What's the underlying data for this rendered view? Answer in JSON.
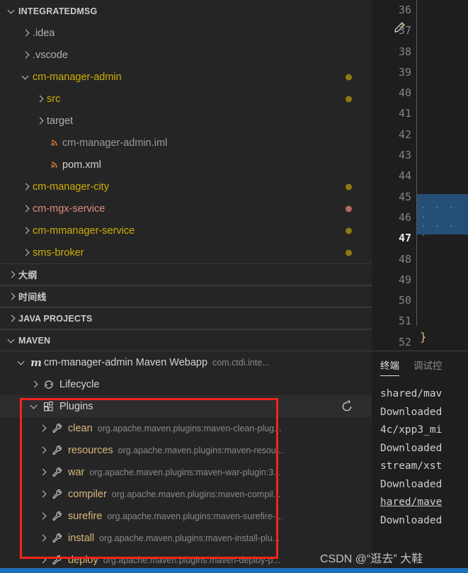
{
  "theme": {
    "sidebar_bg": "#252526",
    "editor_bg": "#1e1e1e",
    "accent_red": "#f5231b",
    "status_blue": "#1d6fb8",
    "folder_yellow": "#dcb67a",
    "modified_dot": "#8c7a11",
    "error_dot": "#b5695f",
    "selection_blue": "#264f78"
  },
  "explorer": {
    "root": {
      "label": "INTEGRATEDMSG",
      "expanded": true
    },
    "items": [
      {
        "label": ".idea",
        "kind": "folder",
        "indent": 1,
        "expanded": false,
        "color": "#b0b0b0",
        "dot": null
      },
      {
        "label": ".vscode",
        "kind": "folder",
        "indent": 1,
        "expanded": false,
        "color": "#b0b0b0",
        "dot": null
      },
      {
        "label": "cm-manager-admin",
        "kind": "folder",
        "indent": 1,
        "expanded": true,
        "color": "#cfae00",
        "dot": "#8c7a11"
      },
      {
        "label": "src",
        "kind": "folder",
        "indent": 2,
        "expanded": false,
        "color": "#cfae00",
        "dot": "#8c7a11"
      },
      {
        "label": "target",
        "kind": "folder",
        "indent": 2,
        "expanded": false,
        "color": "#b0b0b0",
        "dot": null
      },
      {
        "label": "cm-manager-admin.iml",
        "kind": "xml",
        "indent": 2,
        "expanded": null,
        "color": "#9b9b9b",
        "dot": null
      },
      {
        "label": "pom.xml",
        "kind": "xml",
        "indent": 2,
        "expanded": null,
        "color": "#d4d4d4",
        "dot": null
      },
      {
        "label": "cm-manager-city",
        "kind": "folder",
        "indent": 1,
        "expanded": false,
        "color": "#cfae00",
        "dot": "#8c7a11"
      },
      {
        "label": "cm-mgx-service",
        "kind": "folder",
        "indent": 1,
        "expanded": false,
        "color": "#e08b7c",
        "dot": "#b5695f"
      },
      {
        "label": "cm-mmanager-service",
        "kind": "folder",
        "indent": 1,
        "expanded": false,
        "color": "#cfae00",
        "dot": "#8c7a11"
      },
      {
        "label": "sms-broker",
        "kind": "folder",
        "indent": 1,
        "expanded": false,
        "color": "#cfae00",
        "dot": "#8c7a11"
      }
    ]
  },
  "panels": [
    {
      "label": "大纲",
      "expanded": false,
      "cjk": true
    },
    {
      "label": "时间线",
      "expanded": false,
      "cjk": true
    },
    {
      "label": "JAVA PROJECTS",
      "expanded": false,
      "cjk": false
    },
    {
      "label": "MAVEN",
      "expanded": true,
      "cjk": false
    }
  ],
  "maven": {
    "project": {
      "label": "cm-manager-admin Maven Webapp",
      "group": "com.ctdi.inte...",
      "icon": "maven-m-icon",
      "expanded": true
    },
    "lifecycle": {
      "label": "Lifecycle",
      "icon": "sync-icon",
      "expanded": false
    },
    "plugins_node": {
      "label": "Plugins",
      "icon": "extensions-grid-icon",
      "expanded": true,
      "selected": true,
      "refresh_icon": "refresh-icon"
    },
    "plugins": [
      {
        "name": "clean",
        "coords": "org.apache.maven.plugins:maven-clean-plug..."
      },
      {
        "name": "resources",
        "coords": "org.apache.maven.plugins:maven-resou..."
      },
      {
        "name": "war",
        "coords": "org.apache.maven.plugins:maven-war-plugin:3..."
      },
      {
        "name": "compiler",
        "coords": "org.apache.maven.plugins:maven-compil..."
      },
      {
        "name": "surefire",
        "coords": "org.apache.maven.plugins:maven-surefire-..."
      },
      {
        "name": "install",
        "coords": "org.apache.maven.plugins:maven-install-plu..."
      },
      {
        "name": "deploy",
        "coords": "org.apache.maven.plugins:maven-deploy-p..."
      }
    ]
  },
  "editor": {
    "line_numbers": [
      "36",
      "37",
      "38",
      "39",
      "40",
      "41",
      "42",
      "43",
      "44",
      "45",
      "46",
      "47",
      "48",
      "49",
      "50",
      "51",
      "52"
    ],
    "active_line": "47",
    "edit_icon_line": "37",
    "closing_brace": "}",
    "selection_dots": ". . . ."
  },
  "panel": {
    "tabs": [
      {
        "label": "终端",
        "active": true
      },
      {
        "label": "调试控",
        "active": false
      }
    ],
    "terminal_lines": [
      {
        "text": "shared/mav",
        "link": false
      },
      {
        "text": "Downloaded",
        "link": false
      },
      {
        "text": "4c/xpp3_mi",
        "link": false
      },
      {
        "text": "Downloaded",
        "link": false
      },
      {
        "text": "stream/xst",
        "link": false
      },
      {
        "text": "Downloaded",
        "link": false
      },
      {
        "text": "hared/mave",
        "link": true
      },
      {
        "text": "Downloaded",
        "link": false
      }
    ]
  },
  "watermark": {
    "text": "CSDN @“逛去” 大鞋"
  }
}
